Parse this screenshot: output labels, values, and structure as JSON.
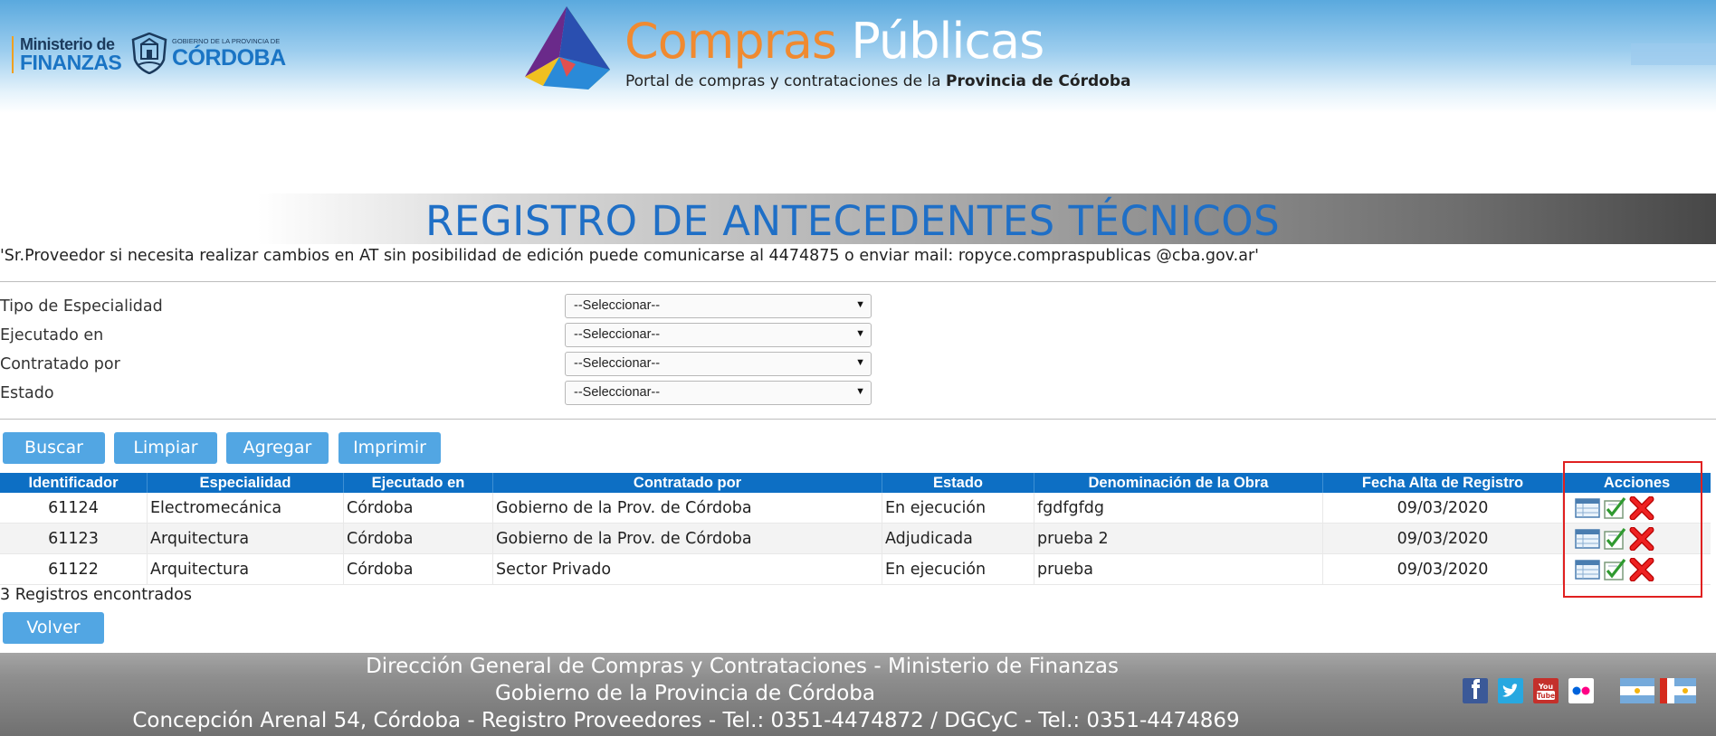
{
  "header": {
    "ministerio_line1": "Ministerio de",
    "ministerio_line2": "FINANZAS",
    "gobierno_small": "GOBIERNO DE LA PROVINCIA DE",
    "gobierno_big": "CÓRDOBA",
    "title_part1": "Compras",
    "title_part2": "Públicas",
    "subtitle_prefix": "Portal de compras y contrataciones de la",
    "subtitle_bold": "Provincia de Córdoba"
  },
  "page": {
    "title": "REGISTRO DE ANTECEDENTES TÉCNICOS",
    "notice": "'Sr.Proveedor si necesita realizar cambios en AT sin posibilidad de edición puede comunicarse al 4474875 o enviar mail: ropyce.compraspublicas @cba.gov.ar'"
  },
  "filters": [
    {
      "label": "Tipo de Especialidad",
      "value": "--Seleccionar--"
    },
    {
      "label": "Ejecutado en",
      "value": "--Seleccionar--"
    },
    {
      "label": "Contratado por",
      "value": "--Seleccionar--"
    },
    {
      "label": "Estado",
      "value": "--Seleccionar--"
    }
  ],
  "buttons": {
    "buscar": "Buscar",
    "limpiar": "Limpiar",
    "agregar": "Agregar",
    "imprimir": "Imprimir",
    "volver": "Volver"
  },
  "table": {
    "columns": [
      "Identificador",
      "Especialidad",
      "Ejecutado en",
      "Contratado por",
      "Estado",
      "Denominación de la Obra",
      "Fecha Alta de Registro",
      "Acciones"
    ],
    "rows": [
      [
        "61124",
        "Electromecánica",
        "Córdoba",
        "Gobierno de la Prov. de Córdoba",
        "En ejecución",
        "fgdfgfdg",
        "09/03/2020"
      ],
      [
        "61123",
        "Arquitectura",
        "Córdoba",
        "Gobierno de la Prov. de Córdoba",
        "Adjudicada",
        "prueba 2",
        "09/03/2020"
      ],
      [
        "61122",
        "Arquitectura",
        "Córdoba",
        "Sector Privado",
        "En ejecución",
        "prueba",
        "09/03/2020"
      ]
    ],
    "row_actions": [
      "view-icon",
      "edit-icon",
      "delete-icon"
    ]
  },
  "results_count": "3 Registros encontrados",
  "footer": {
    "line1": "Dirección General de Compras y Contrataciones - Ministerio de Finanzas",
    "line2": "Gobierno de la Provincia de Córdoba",
    "line3": "Concepción Arenal 54, Córdoba - Registro Proveedores - Tel.: 0351-4474872 / DGCyC - Tel.: 0351-4474869"
  },
  "social": [
    "facebook-icon",
    "twitter-icon",
    "youtube-icon",
    "flickr-icon"
  ],
  "colors": {
    "accent_blue": "#0d6fc4",
    "button_blue": "#52a6e3",
    "title_blue": "#1f6fc6",
    "title_orange": "#f08a30",
    "highlight_red": "#e02020"
  }
}
